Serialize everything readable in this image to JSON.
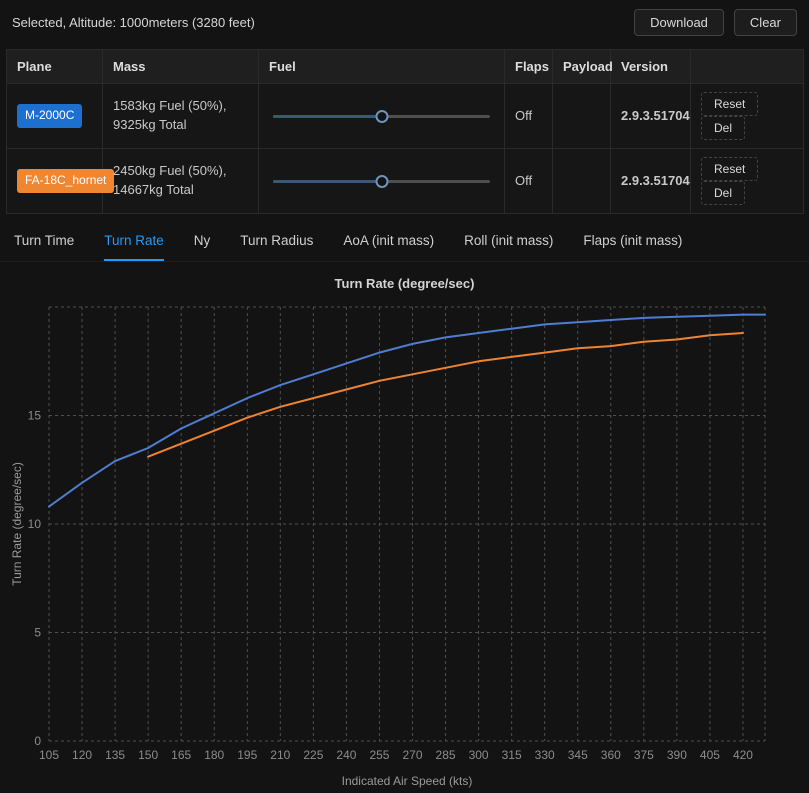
{
  "topbar": {
    "selected_text": "Selected, Altitude: 1000meters (3280 feet)",
    "download_label": "Download",
    "clear_label": "Clear"
  },
  "table": {
    "headers": {
      "plane": "Plane",
      "mass": "Mass",
      "fuel": "Fuel",
      "flaps": "Flaps",
      "payload": "Payload",
      "version": "Version",
      "actions": ""
    },
    "rows": [
      {
        "plane": "M-2000C",
        "badge_color": "#1d6fd0",
        "mass": "1583kg Fuel (50%), 9325kg Total",
        "fuel_percent": 50,
        "flaps": "Off",
        "payload": "",
        "version": "2.9.3.51704",
        "reset_label": "Reset",
        "del_label": "Del"
      },
      {
        "plane": "FA-18C_hornet",
        "badge_color": "#ef8732",
        "mass": "2450kg Fuel (50%), 14667kg Total",
        "fuel_percent": 50,
        "flaps": "Off",
        "payload": "",
        "version": "2.9.3.51704",
        "reset_label": "Reset",
        "del_label": "Del"
      }
    ]
  },
  "tabs": [
    {
      "label": "Turn Time",
      "active": false
    },
    {
      "label": "Turn Rate",
      "active": true
    },
    {
      "label": "Ny",
      "active": false
    },
    {
      "label": "Turn Radius",
      "active": false
    },
    {
      "label": "AoA (init mass)",
      "active": false
    },
    {
      "label": "Roll (init mass)",
      "active": false
    },
    {
      "label": "Flaps (init mass)",
      "active": false
    }
  ],
  "chart_data": {
    "type": "line",
    "title": "Turn Rate (degree/sec)",
    "xlabel": "Indicated Air Speed (kts)",
    "ylabel": "Turn Rate (degree/sec)",
    "xlim": [
      105,
      430
    ],
    "ylim": [
      0,
      20
    ],
    "x_ticks": [
      105,
      120,
      135,
      150,
      165,
      180,
      195,
      210,
      225,
      240,
      255,
      270,
      285,
      300,
      315,
      330,
      345,
      360,
      375,
      390,
      405,
      420
    ],
    "y_ticks": [
      0,
      5,
      10,
      15
    ],
    "y_grid": [
      0,
      5,
      10,
      15,
      20
    ],
    "grid": "dashed",
    "legend_position": "none",
    "series": [
      {
        "name": "M-2000C",
        "color": "#4e7dd1",
        "x": [
          105,
          120,
          135,
          150,
          165,
          180,
          195,
          210,
          225,
          240,
          255,
          270,
          285,
          300,
          315,
          330,
          345,
          360,
          375,
          390,
          405,
          420,
          430
        ],
        "y": [
          10.8,
          11.9,
          12.9,
          13.5,
          14.4,
          15.1,
          15.8,
          16.4,
          16.9,
          17.4,
          17.9,
          18.3,
          18.6,
          18.8,
          19.0,
          19.2,
          19.3,
          19.4,
          19.5,
          19.55,
          19.6,
          19.65,
          19.65
        ]
      },
      {
        "name": "FA-18C_hornet",
        "color": "#ee8432",
        "x": [
          150,
          165,
          180,
          195,
          210,
          225,
          240,
          255,
          270,
          285,
          300,
          315,
          330,
          345,
          360,
          375,
          390,
          405,
          420
        ],
        "y": [
          13.1,
          13.7,
          14.3,
          14.9,
          15.4,
          15.8,
          16.2,
          16.6,
          16.9,
          17.2,
          17.5,
          17.7,
          17.9,
          18.1,
          18.2,
          18.4,
          18.5,
          18.7,
          18.8
        ]
      }
    ]
  }
}
